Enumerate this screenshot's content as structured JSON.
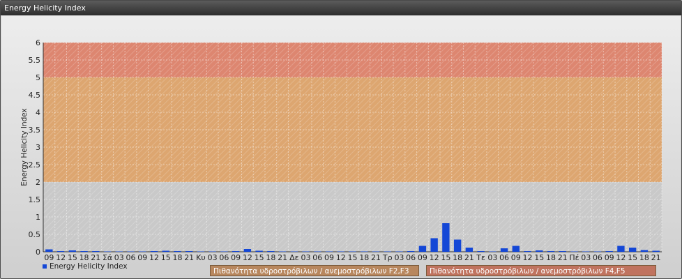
{
  "window": {
    "title": "Energy Helicity Index"
  },
  "chart_data": {
    "type": "bar",
    "ylabel": "Energy Helicity Index",
    "ylim": [
      0,
      6
    ],
    "yticks": [
      "0",
      "0.5",
      "1",
      "1.5",
      "2",
      "2.5",
      "3",
      "3.5",
      "4",
      "4.5",
      "5",
      "5.5",
      "6"
    ],
    "grid": true,
    "categories": [
      "09",
      "12",
      "15",
      "18",
      "21",
      "Σά",
      "03",
      "06",
      "09",
      "12",
      "15",
      "18",
      "21",
      "Κυ",
      "03",
      "06",
      "09",
      "12",
      "15",
      "18",
      "21",
      "Δε",
      "03",
      "06",
      "09",
      "12",
      "15",
      "18",
      "21",
      "Τρ",
      "03",
      "06",
      "09",
      "12",
      "15",
      "18",
      "21",
      "Τε",
      "03",
      "06",
      "09",
      "12",
      "15",
      "18",
      "21",
      "Πέ",
      "03",
      "06",
      "09",
      "12",
      "15",
      "18",
      "21"
    ],
    "series": [
      {
        "name": "Energy Helicity Index",
        "color": "#1447d6",
        "values": [
          0.07,
          0.02,
          0.04,
          0.02,
          0.02,
          0.01,
          0.01,
          0.01,
          0.01,
          0.02,
          0.03,
          0.02,
          0.02,
          0.01,
          0.01,
          0.01,
          0.02,
          0.08,
          0.03,
          0.02,
          0.01,
          0.01,
          0.01,
          0.01,
          0.01,
          0.01,
          0.01,
          0.01,
          0.01,
          0.01,
          0.01,
          0.02,
          0.17,
          0.39,
          0.82,
          0.35,
          0.12,
          0.02,
          0.01,
          0.1,
          0.17,
          0.02,
          0.04,
          0.02,
          0.02,
          0.01,
          0.01,
          0.01,
          0.02,
          0.17,
          0.12,
          0.05,
          0.03
        ]
      }
    ],
    "bands": [
      {
        "from": 2,
        "to": 5,
        "color": "#e0a060",
        "label": "Πιθανότητα υδροστρόβιλων / ανεμοστρόβιλων F2,F3"
      },
      {
        "from": 5,
        "to": 6,
        "color": "#e07a60",
        "label": "Πιθανότητα υδροστρόβιλων / ανεμοστρόβιλων F4,F5"
      }
    ],
    "legend": "bottom-left"
  }
}
